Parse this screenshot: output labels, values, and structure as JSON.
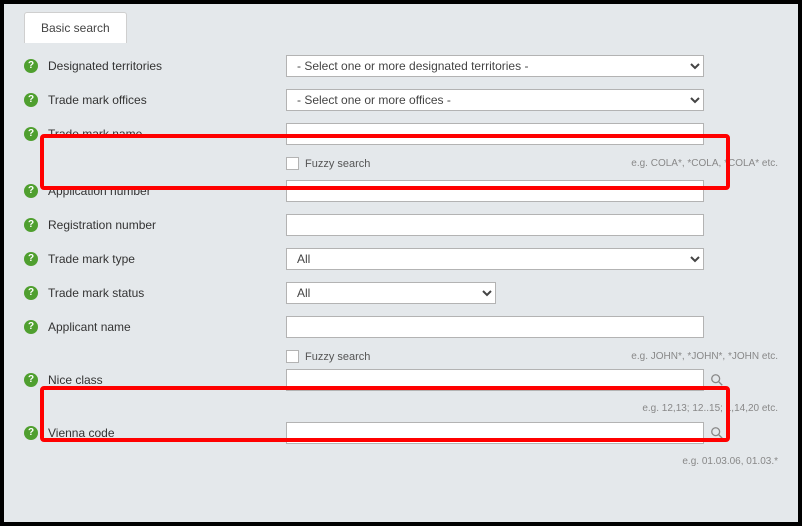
{
  "tab": {
    "label": "Basic search"
  },
  "fields": {
    "territories": {
      "label": "Designated territories",
      "placeholder": "- Select one or more designated territories -"
    },
    "offices": {
      "label": "Trade mark offices",
      "placeholder": "- Select one or more offices -"
    },
    "name": {
      "label": "Trade mark name",
      "fuzzy": "Fuzzy search",
      "hint": "e.g. COLA*, *COLA, *COLA* etc."
    },
    "appnum": {
      "label": "Application number"
    },
    "regnum": {
      "label": "Registration number"
    },
    "type": {
      "label": "Trade mark type",
      "value": "All"
    },
    "status": {
      "label": "Trade mark status",
      "value": "All"
    },
    "applicant": {
      "label": "Applicant name",
      "fuzzy": "Fuzzy search",
      "hint": "e.g. JOHN*, *JOHN*, *JOHN etc."
    },
    "nice": {
      "label": "Nice class",
      "hint": "e.g. 12,13; 12..15; 1,14,20 etc."
    },
    "vienna": {
      "label": "Vienna code",
      "hint": "e.g. 01.03.06, 01.03.*"
    }
  }
}
